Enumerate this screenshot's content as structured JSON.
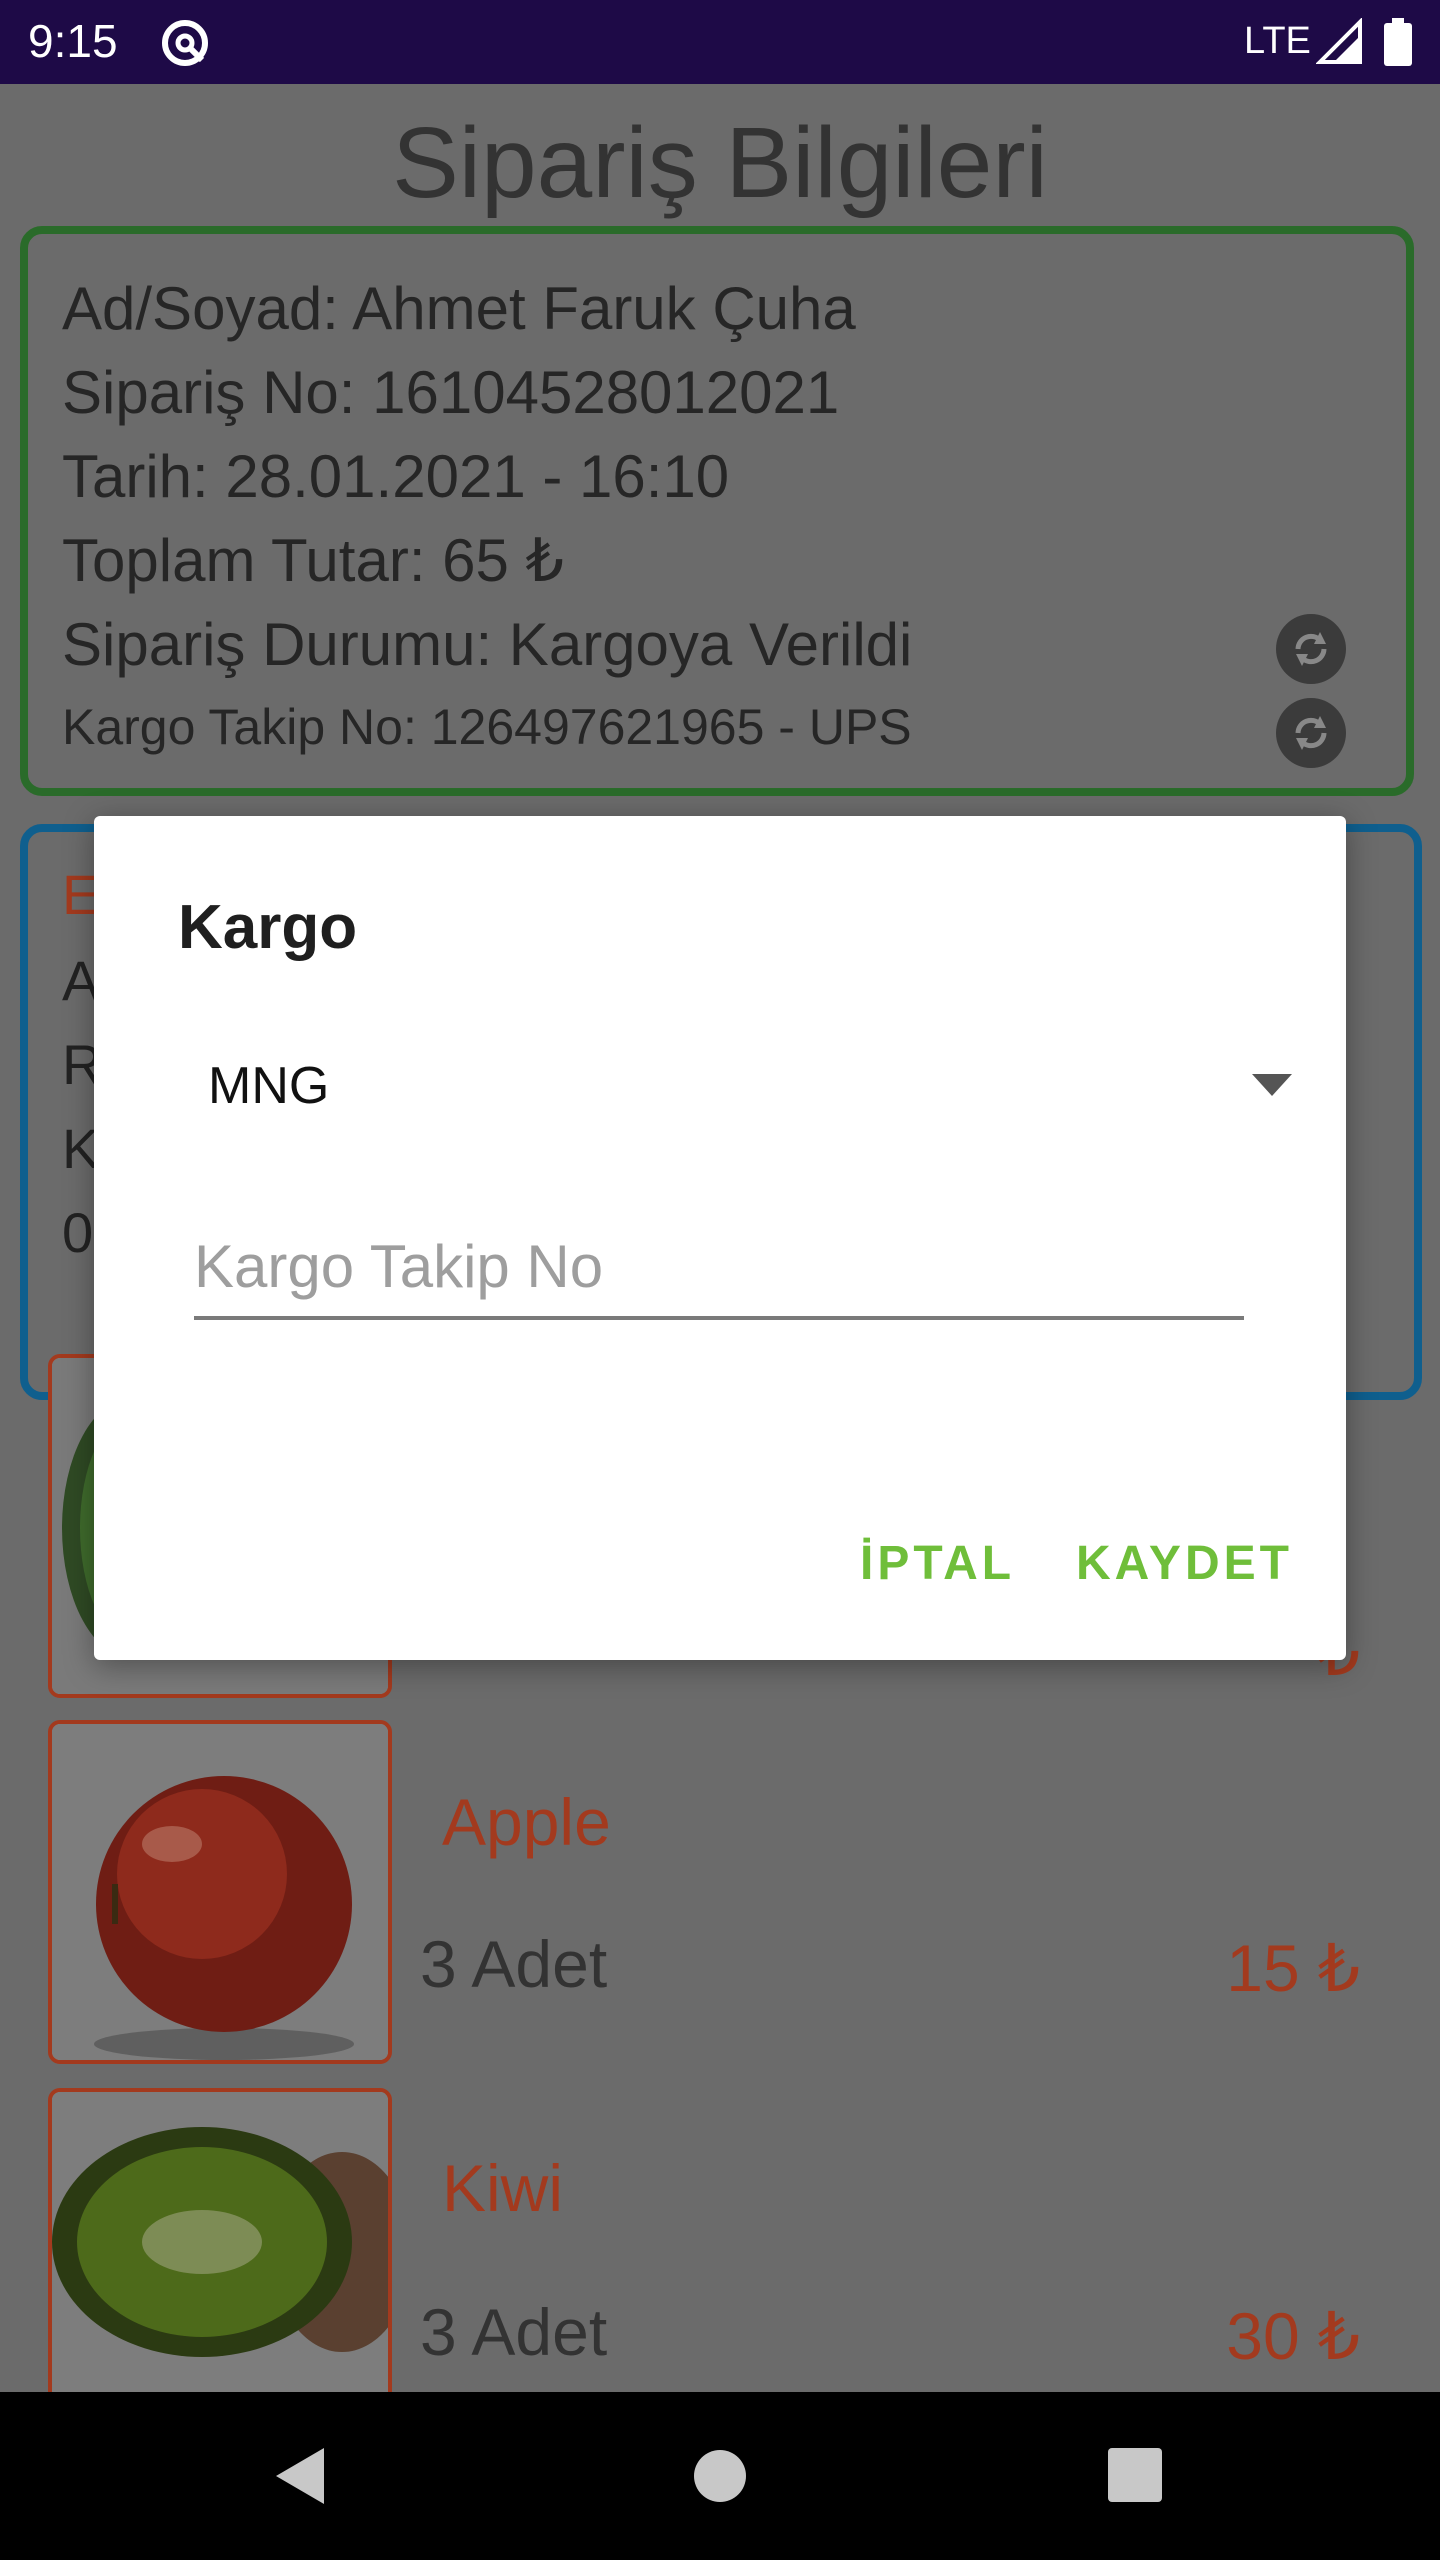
{
  "status_bar": {
    "time": "9:15",
    "network": "LTE"
  },
  "page": {
    "title": "Sipariş Bilgileri",
    "order_info": {
      "name": "Ad/Soyad: Ahmet Faruk Çuha",
      "order_no": "Sipariş No: 16104528012021",
      "date": "Tarih: 28.01.2021 - 16:10",
      "total": "Toplam Tutar: 65 ₺",
      "status": "Sipariş Durumu: Kargoya Verildi",
      "tracking": "Kargo Takip No: 126497621965 - UPS"
    },
    "address_partial": [
      "E",
      "A",
      "R",
      "K",
      "0"
    ],
    "items": [
      {
        "name": "Apple",
        "qty": "3 Adet",
        "price": "15 ₺"
      },
      {
        "name": "Kiwi",
        "qty": "3 Adet",
        "price": "30 ₺"
      }
    ],
    "partial_price_fragment": "₺"
  },
  "dialog": {
    "title": "Kargo",
    "spinner_value": "MNG",
    "tracking_placeholder": "Kargo Takip No",
    "cancel_label": "İPTAL",
    "save_label": "KAYDET"
  },
  "colors": {
    "status_bar": "#1e0a47",
    "accent_green": "#6fbe3a",
    "item_red": "#a33a1e",
    "card_green_border": "#2a6b2a",
    "card_blue_border": "#0f5f8e"
  }
}
